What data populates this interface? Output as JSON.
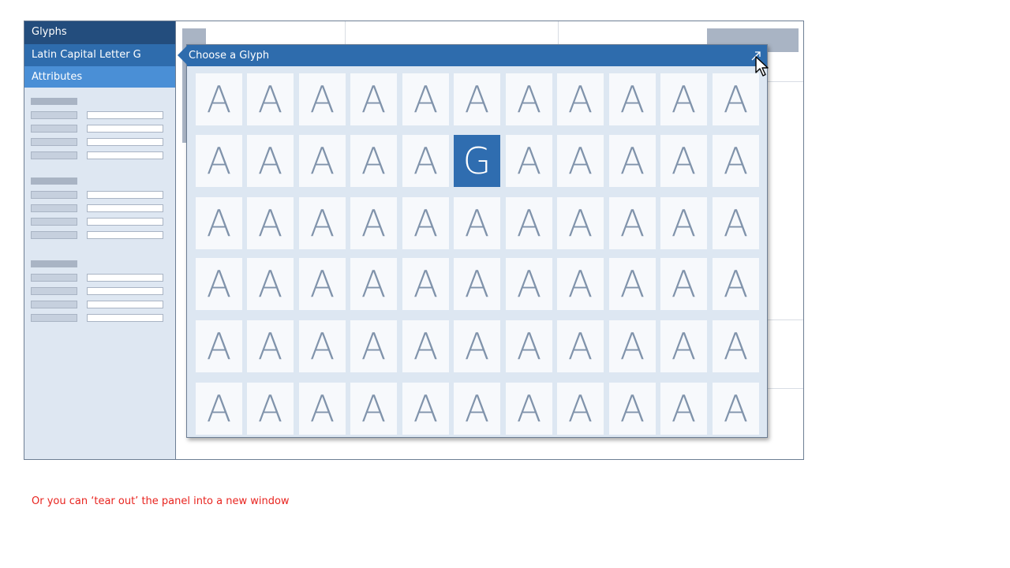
{
  "sidebar": {
    "title": "Glyphs",
    "selected_glyph": "Latin Capital Letter G",
    "section": "Attributes"
  },
  "popup": {
    "title": "Choose a Glyph",
    "tearout_icon": "tear-out-arrow-icon",
    "glyphs": [
      [
        "A",
        "A",
        "A",
        "A",
        "A",
        "A",
        "A",
        "A",
        "A",
        "A",
        "A"
      ],
      [
        "A",
        "A",
        "A",
        "A",
        "A",
        "G",
        "A",
        "A",
        "A",
        "A",
        "A"
      ],
      [
        "A",
        "A",
        "A",
        "A",
        "A",
        "A",
        "A",
        "A",
        "A",
        "A",
        "A"
      ],
      [
        "A",
        "A",
        "A",
        "A",
        "A",
        "A",
        "A",
        "A",
        "A",
        "A",
        "A"
      ],
      [
        "A",
        "A",
        "A",
        "A",
        "A",
        "A",
        "A",
        "A",
        "A",
        "A",
        "A"
      ],
      [
        "A",
        "A",
        "A",
        "A",
        "A",
        "A",
        "A",
        "A",
        "A",
        "A",
        "A"
      ]
    ],
    "selected": {
      "row": 1,
      "col": 5
    }
  },
  "annotation": "Or you can ‘tear out’ the panel into a new window",
  "colors": {
    "accent": "#2e6cad",
    "header_dark": "#234d7d",
    "annotation": "#e8241f"
  }
}
